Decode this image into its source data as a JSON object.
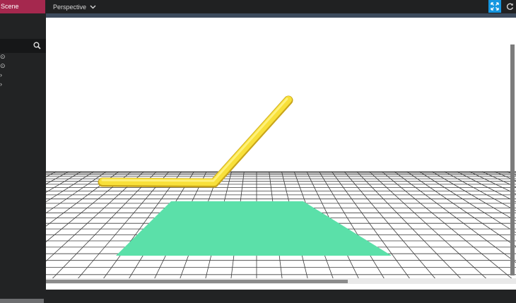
{
  "scene_tab": {
    "label": "Scene"
  },
  "view_dropdown": {
    "label": "Perspective"
  },
  "sidebar": {
    "search": {
      "icon": "search-icon"
    },
    "tree": [
      {
        "label": "⊙",
        "icon": "eye-icon"
      },
      {
        "label": "⊙",
        "icon": "eye-icon"
      },
      {
        "label": "›",
        "icon": "item-marker"
      },
      {
        "label": "›",
        "icon": "item-marker"
      }
    ]
  },
  "toolbar": {
    "expand_icon": "expand-icon",
    "refresh_icon": "refresh-icon"
  },
  "viewport": {
    "ground_patch_color": "#5be0a9",
    "rod_color": "#f8e03a"
  }
}
